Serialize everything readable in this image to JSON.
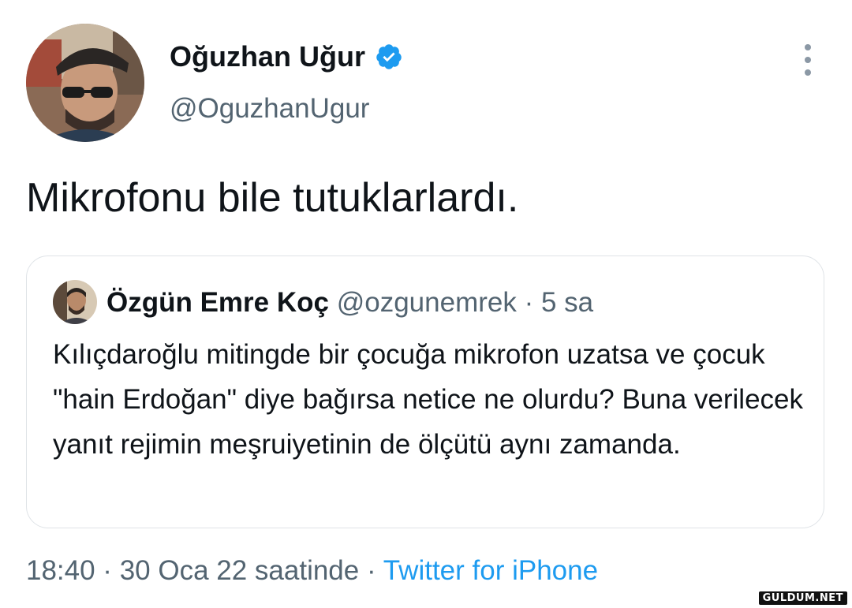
{
  "tweet": {
    "display_name": "Oğuzhan Uğur",
    "handle": "@OguzhanUgur",
    "verified": true,
    "text": "Mikrofonu bile tutuklarlardı.",
    "timestamp": "18:40 · 30 Oca 22 saatinde",
    "separator": " · ",
    "source": "Twitter for iPhone"
  },
  "quoted_tweet": {
    "display_name": "Özgün Emre Koç",
    "handle": "@ozgunemrek",
    "separator": " · ",
    "age": "5 sa",
    "text": "Kılıçdaroğlu mitingde bir çocuğa mikrofon uzatsa ve çocuk \"hain Erdoğan\" diye bağırsa netice ne olurdu? Buna verilecek yanıt rejimin meşruiyetinin de ölçütü aynı zamanda."
  },
  "icons": {
    "verified": "verified-badge-icon",
    "more": "more-vertical-icon"
  },
  "colors": {
    "accent": "#1d9bf0",
    "text_primary": "#0f1419",
    "text_secondary": "#536471",
    "border": "#dfe3e7"
  },
  "watermark": "GULDUM.NET"
}
